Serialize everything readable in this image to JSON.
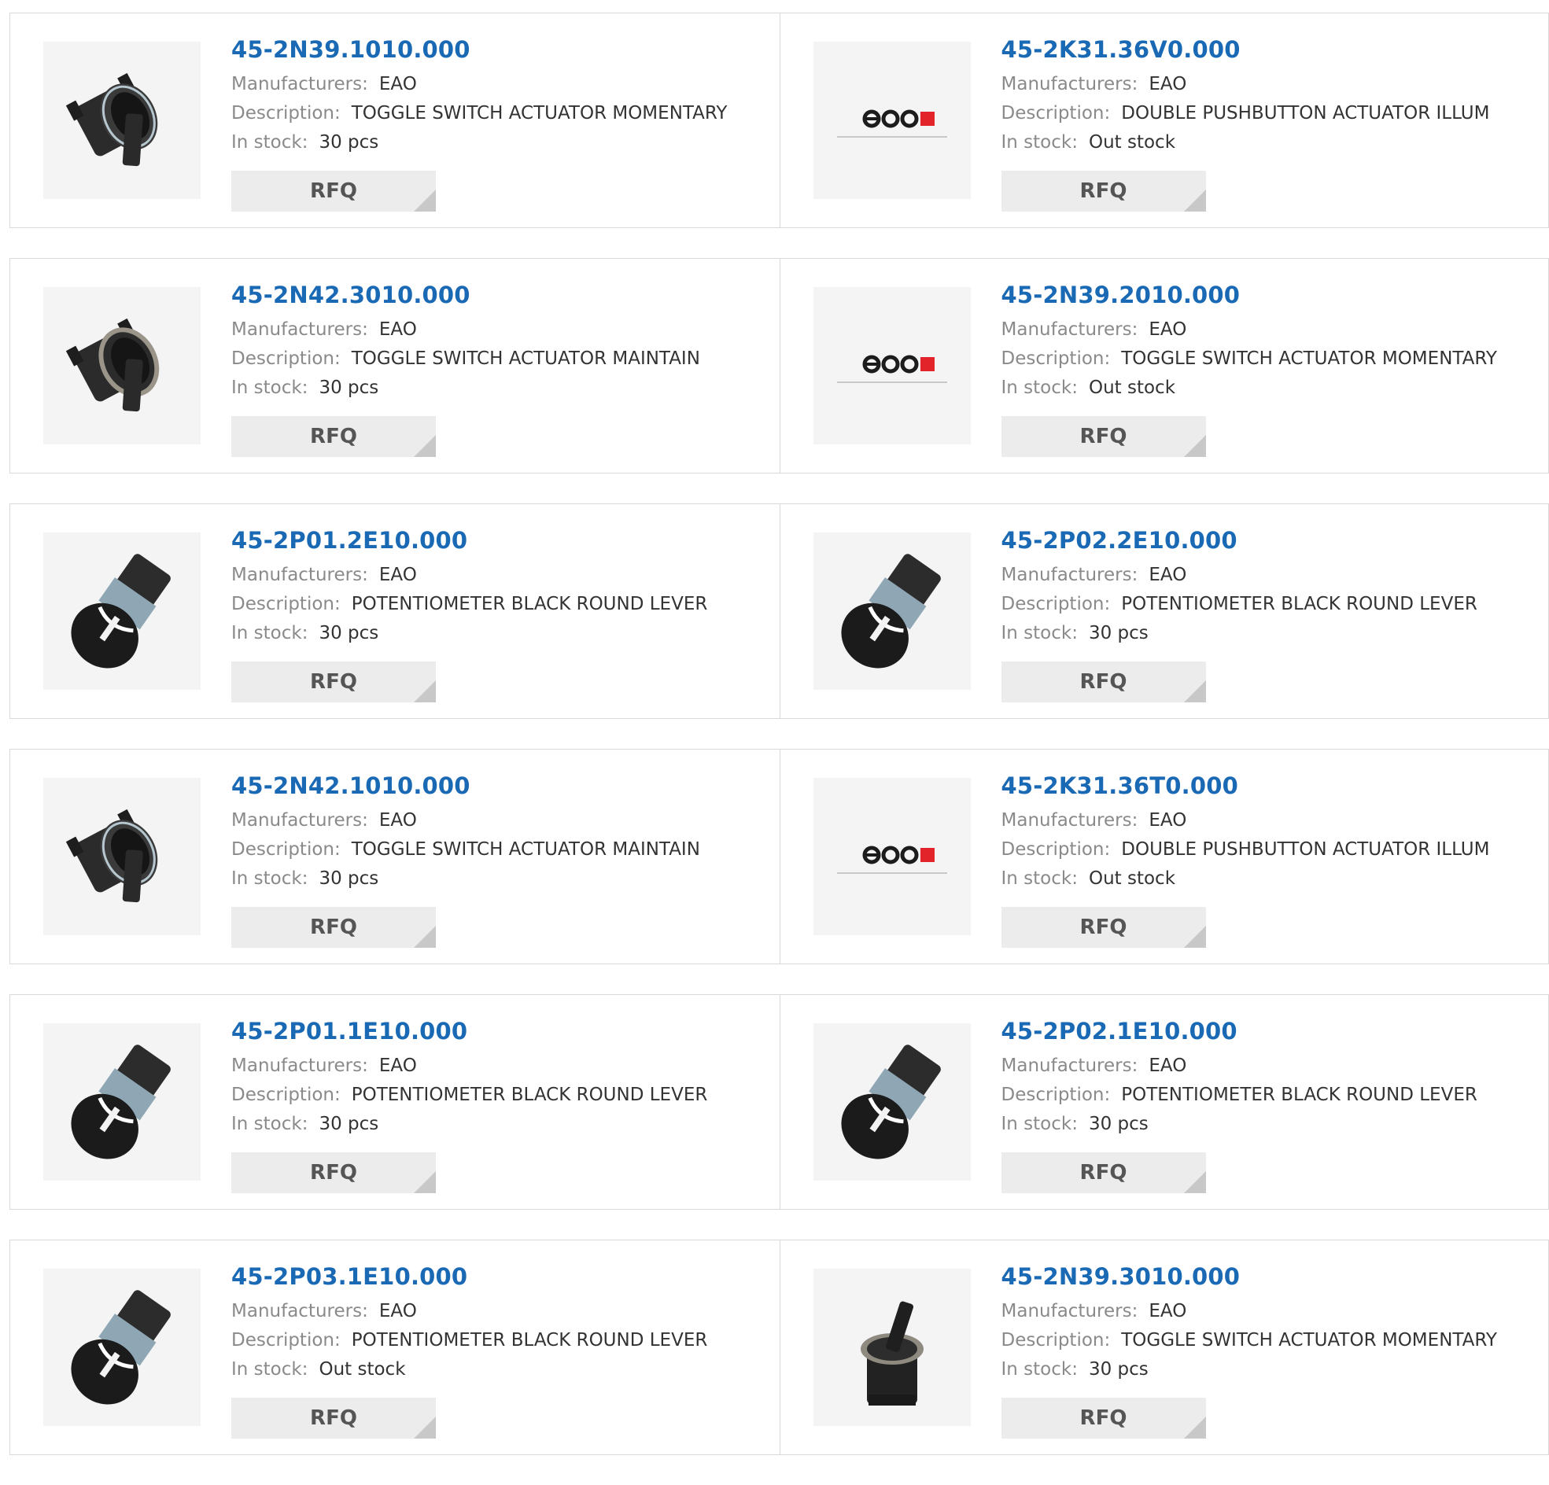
{
  "labels": {
    "manufacturer": "Manufacturers:",
    "description": "Description:",
    "stock": "In stock:",
    "rfq": "RFQ"
  },
  "colors": {
    "link": "#1a69b4",
    "eao_red": "#e2232a"
  },
  "products": [
    {
      "part": "45-2N39.1010.000",
      "manufacturer": "EAO",
      "description": "TOGGLE SWITCH ACTUATOR MOMENTARY",
      "stock": "30 pcs",
      "image": "toggle-switch-image"
    },
    {
      "part": "45-2K31.36V0.000",
      "manufacturer": "EAO",
      "description": "DOUBLE PUSHBUTTON ACTUATOR ILLUM",
      "stock": "Out stock",
      "image": "eao-logo-image"
    },
    {
      "part": "45-2N42.3010.000",
      "manufacturer": "EAO",
      "description": "TOGGLE SWITCH ACTUATOR MAINTAIN",
      "stock": "30 pcs",
      "image": "toggle-switch-silver-ring-image"
    },
    {
      "part": "45-2N39.2010.000",
      "manufacturer": "EAO",
      "description": "TOGGLE SWITCH ACTUATOR MOMENTARY",
      "stock": "Out stock",
      "image": "eao-logo-image"
    },
    {
      "part": "45-2P01.2E10.000",
      "manufacturer": "EAO",
      "description": "POTENTIOMETER BLACK ROUND LEVER",
      "stock": "30 pcs",
      "image": "potentiometer-knob-image"
    },
    {
      "part": "45-2P02.2E10.000",
      "manufacturer": "EAO",
      "description": "POTENTIOMETER BLACK ROUND LEVER",
      "stock": "30 pcs",
      "image": "potentiometer-knob-image"
    },
    {
      "part": "45-2N42.1010.000",
      "manufacturer": "EAO",
      "description": "TOGGLE SWITCH ACTUATOR MAINTAIN",
      "stock": "30 pcs",
      "image": "toggle-switch-image"
    },
    {
      "part": "45-2K31.36T0.000",
      "manufacturer": "EAO",
      "description": "DOUBLE PUSHBUTTON ACTUATOR ILLUM",
      "stock": "Out stock",
      "image": "eao-logo-image"
    },
    {
      "part": "45-2P01.1E10.000",
      "manufacturer": "EAO",
      "description": "POTENTIOMETER BLACK ROUND LEVER",
      "stock": "30 pcs",
      "image": "potentiometer-knob-image"
    },
    {
      "part": "45-2P02.1E10.000",
      "manufacturer": "EAO",
      "description": "POTENTIOMETER BLACK ROUND LEVER",
      "stock": "30 pcs",
      "image": "potentiometer-knob-image"
    },
    {
      "part": "45-2P03.1E10.000",
      "manufacturer": "EAO",
      "description": "POTENTIOMETER BLACK ROUND LEVER",
      "stock": "Out stock",
      "image": "potentiometer-knob-image"
    },
    {
      "part": "45-2N39.3010.000",
      "manufacturer": "EAO",
      "description": "TOGGLE SWITCH ACTUATOR MOMENTARY",
      "stock": "30 pcs",
      "image": "toggle-switch-upright-image"
    }
  ]
}
